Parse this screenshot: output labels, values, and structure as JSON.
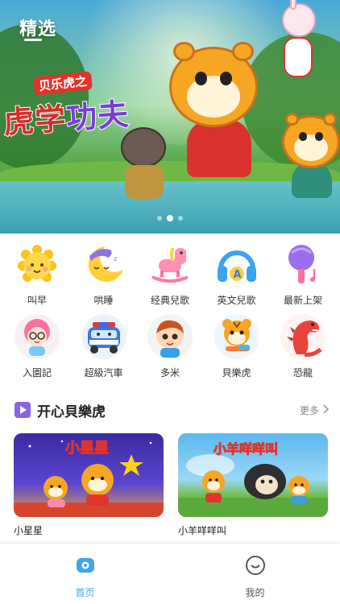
{
  "header": {
    "title": "精选"
  },
  "banner": {
    "logo_sub": "贝乐虎之",
    "logo_main_a": "虎学",
    "logo_main_b": "功夫",
    "slide_count": 3,
    "active_slide": 2
  },
  "categories": [
    {
      "label": "叫早",
      "icon": "sun-icon"
    },
    {
      "label": "哄睡",
      "icon": "moon-icon"
    },
    {
      "label": "经典兒歌",
      "icon": "rocking-horse-icon"
    },
    {
      "label": "英文兒歌",
      "icon": "headphones-icon"
    },
    {
      "label": "最新上架",
      "icon": "microphone-icon"
    },
    {
      "label": "入園記",
      "icon": "girl-icon"
    },
    {
      "label": "超級汽車",
      "icon": "police-car-icon"
    },
    {
      "label": "多米",
      "icon": "boy-icon"
    },
    {
      "label": "貝樂虎",
      "icon": "tiger-icon"
    },
    {
      "label": "恐龍",
      "icon": "dinosaur-icon"
    }
  ],
  "section": {
    "title": "开心貝樂虎",
    "more_label": "更多"
  },
  "cards": [
    {
      "title": "小星星",
      "thumb_text": "小星星",
      "thumb_bg": "#4f3bb8"
    },
    {
      "title": "小羊咩咩叫",
      "thumb_text": "小羊咩咩叫",
      "thumb_bg": "#4aa8e0"
    }
  ],
  "tabbar": {
    "tabs": [
      {
        "label": "首页",
        "active": true,
        "icon": "home-tv-icon"
      },
      {
        "label": "我的",
        "active": false,
        "icon": "profile-icon"
      }
    ],
    "active_color": "#3ea6ea",
    "inactive_color": "#555555"
  }
}
